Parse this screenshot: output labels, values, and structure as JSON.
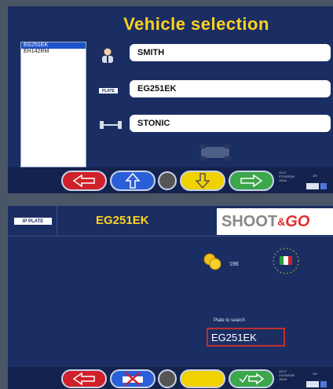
{
  "screen1": {
    "title": "Vehicle selection",
    "list": [
      "EG251EK",
      "EH142RM"
    ],
    "fields": {
      "owner": "SMITH",
      "plate_label": "PLATE",
      "plate": "EG251EK",
      "model": "STONIC"
    },
    "status_lines": [
      "13:17",
      "27/10/2020",
      "15:04",
      "1/5"
    ]
  },
  "screen2": {
    "plate_badge": "IP PLATE",
    "plate_header": "EG251EK",
    "brand_shoot": "SHOOT",
    "brand_amp": "&",
    "brand_go": "GO",
    "coins_count": "196",
    "search_label": "Plate to search",
    "search_value": "EG251EK",
    "status_lines": [
      "13:17",
      "27/10/2020",
      "15:04",
      "1/5"
    ]
  },
  "colors": {
    "panel": "#1b2e63",
    "title": "#ffd21f",
    "red_button": "#d0202a",
    "blue_button": "#2a5fd8",
    "yellow_button": "#f0d200",
    "green_button": "#3ba64a"
  }
}
